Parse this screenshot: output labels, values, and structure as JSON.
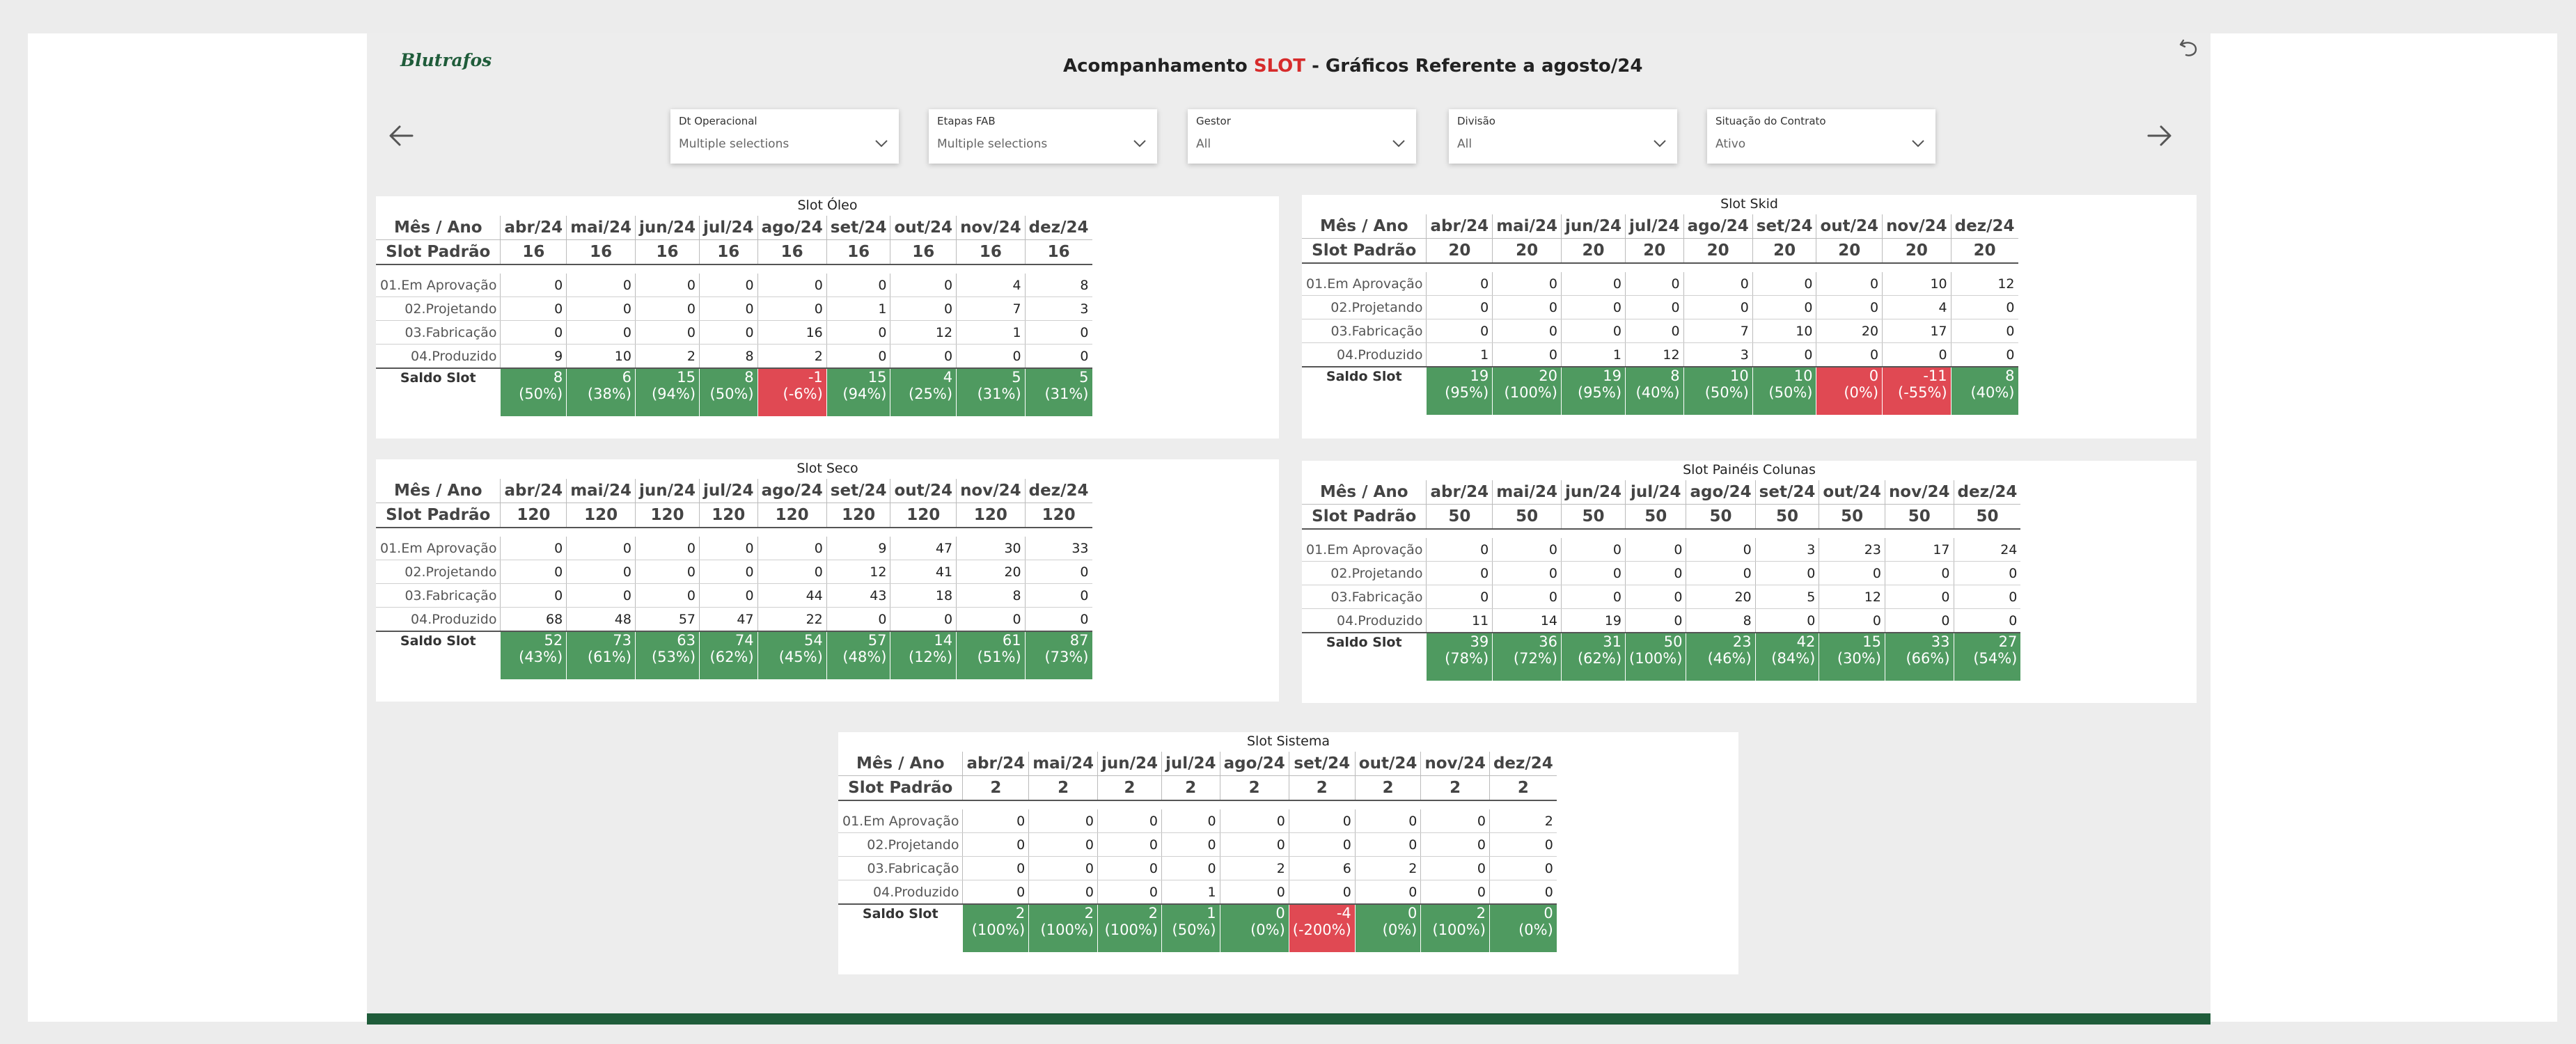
{
  "header": {
    "logo": "Blutrafos",
    "title_prefix": "Acompanhamento",
    "title_accent": "SLOT",
    "title_suffix": " - Gráficos Referente a agosto/24",
    "accent_color": "#d62b2b",
    "brand_color": "#1f5c3a"
  },
  "icons": {
    "undo": "undo-icon",
    "prev": "arrow-left-icon",
    "next": "arrow-right-icon",
    "dropdown": "chevron-down-icon"
  },
  "filters": [
    {
      "label": "Dt Operacional",
      "value": "Multiple selections"
    },
    {
      "label": "Etapas FAB",
      "value": "Multiple selections"
    },
    {
      "label": "Gestor",
      "value": "All"
    },
    {
      "label": "Divisão",
      "value": "All"
    },
    {
      "label": "Situação do Contrato",
      "value": "Ativo"
    }
  ],
  "table_labels": {
    "header": "Mês / Ano",
    "padrao": "Slot Padrão",
    "saldo": "Saldo Slot"
  },
  "months": [
    "abr/24",
    "mai/24",
    "jun/24",
    "jul/24",
    "ago/24",
    "set/24",
    "out/24",
    "nov/24",
    "dez/24"
  ],
  "stage_labels": [
    "01.Em Aprovação",
    "02.Projetando",
    "03.Fabricação",
    "04.Produzido"
  ],
  "colors": {
    "positive": "#4f9a60",
    "negative": "#e04953"
  },
  "panels": [
    {
      "title": "Slot Óleo",
      "padrao": [
        "16",
        "16",
        "16",
        "16",
        "16",
        "16",
        "16",
        "16",
        "16"
      ],
      "stages": [
        [
          "0",
          "0",
          "0",
          "0",
          "0",
          "0",
          "0",
          "4",
          "8"
        ],
        [
          "0",
          "0",
          "0",
          "0",
          "0",
          "1",
          "0",
          "7",
          "3"
        ],
        [
          "0",
          "0",
          "0",
          "0",
          "16",
          "0",
          "12",
          "1",
          "0"
        ],
        [
          "9",
          "10",
          "2",
          "8",
          "2",
          "0",
          "0",
          "0",
          "0"
        ]
      ],
      "saldo": [
        {
          "v": "8",
          "p": "(50%)",
          "neg": false
        },
        {
          "v": "6",
          "p": "(38%)",
          "neg": false
        },
        {
          "v": "15",
          "p": "(94%)",
          "neg": false
        },
        {
          "v": "8",
          "p": "(50%)",
          "neg": false
        },
        {
          "v": "-1",
          "p": "(-6%)",
          "neg": true
        },
        {
          "v": "15",
          "p": "(94%)",
          "neg": false
        },
        {
          "v": "4",
          "p": "(25%)",
          "neg": false
        },
        {
          "v": "5",
          "p": "(31%)",
          "neg": false
        },
        {
          "v": "5",
          "p": "(31%)",
          "neg": false
        }
      ]
    },
    {
      "title": "Slot Skid",
      "padrao": [
        "20",
        "20",
        "20",
        "20",
        "20",
        "20",
        "20",
        "20",
        "20"
      ],
      "stages": [
        [
          "0",
          "0",
          "0",
          "0",
          "0",
          "0",
          "0",
          "10",
          "12"
        ],
        [
          "0",
          "0",
          "0",
          "0",
          "0",
          "0",
          "0",
          "4",
          "0"
        ],
        [
          "0",
          "0",
          "0",
          "0",
          "7",
          "10",
          "20",
          "17",
          "0"
        ],
        [
          "1",
          "0",
          "1",
          "12",
          "3",
          "0",
          "0",
          "0",
          "0"
        ]
      ],
      "saldo": [
        {
          "v": "19",
          "p": "(95%)",
          "neg": false
        },
        {
          "v": "20",
          "p": "(100%)",
          "neg": false
        },
        {
          "v": "19",
          "p": "(95%)",
          "neg": false
        },
        {
          "v": "8",
          "p": "(40%)",
          "neg": false
        },
        {
          "v": "10",
          "p": "(50%)",
          "neg": false
        },
        {
          "v": "10",
          "p": "(50%)",
          "neg": false
        },
        {
          "v": "0",
          "p": "(0%)",
          "neg": true
        },
        {
          "v": "-11",
          "p": "(-55%)",
          "neg": true
        },
        {
          "v": "8",
          "p": "(40%)",
          "neg": false
        }
      ]
    },
    {
      "title": "Slot Seco",
      "padrao": [
        "120",
        "120",
        "120",
        "120",
        "120",
        "120",
        "120",
        "120",
        "120"
      ],
      "stages": [
        [
          "0",
          "0",
          "0",
          "0",
          "0",
          "9",
          "47",
          "30",
          "33"
        ],
        [
          "0",
          "0",
          "0",
          "0",
          "0",
          "12",
          "41",
          "20",
          "0"
        ],
        [
          "0",
          "0",
          "0",
          "0",
          "44",
          "43",
          "18",
          "8",
          "0"
        ],
        [
          "68",
          "48",
          "57",
          "47",
          "22",
          "0",
          "0",
          "0",
          "0"
        ]
      ],
      "saldo": [
        {
          "v": "52",
          "p": "(43%)",
          "neg": false
        },
        {
          "v": "73",
          "p": "(61%)",
          "neg": false
        },
        {
          "v": "63",
          "p": "(53%)",
          "neg": false
        },
        {
          "v": "74",
          "p": "(62%)",
          "neg": false
        },
        {
          "v": "54",
          "p": "(45%)",
          "neg": false
        },
        {
          "v": "57",
          "p": "(48%)",
          "neg": false
        },
        {
          "v": "14",
          "p": "(12%)",
          "neg": false
        },
        {
          "v": "61",
          "p": "(51%)",
          "neg": false
        },
        {
          "v": "87",
          "p": "(73%)",
          "neg": false
        }
      ]
    },
    {
      "title": "Slot Painéis Colunas",
      "padrao": [
        "50",
        "50",
        "50",
        "50",
        "50",
        "50",
        "50",
        "50",
        "50"
      ],
      "stages": [
        [
          "0",
          "0",
          "0",
          "0",
          "0",
          "3",
          "23",
          "17",
          "24"
        ],
        [
          "0",
          "0",
          "0",
          "0",
          "0",
          "0",
          "0",
          "0",
          "0"
        ],
        [
          "0",
          "0",
          "0",
          "0",
          "20",
          "5",
          "12",
          "0",
          "0"
        ],
        [
          "11",
          "14",
          "19",
          "0",
          "8",
          "0",
          "0",
          "0",
          "0"
        ]
      ],
      "saldo": [
        {
          "v": "39",
          "p": "(78%)",
          "neg": false
        },
        {
          "v": "36",
          "p": "(72%)",
          "neg": false
        },
        {
          "v": "31",
          "p": "(62%)",
          "neg": false
        },
        {
          "v": "50",
          "p": "(100%)",
          "neg": false
        },
        {
          "v": "23",
          "p": "(46%)",
          "neg": false
        },
        {
          "v": "42",
          "p": "(84%)",
          "neg": false
        },
        {
          "v": "15",
          "p": "(30%)",
          "neg": false
        },
        {
          "v": "33",
          "p": "(66%)",
          "neg": false
        },
        {
          "v": "27",
          "p": "(54%)",
          "neg": false
        }
      ]
    },
    {
      "title": "Slot Sistema",
      "padrao": [
        "2",
        "2",
        "2",
        "2",
        "2",
        "2",
        "2",
        "2",
        "2"
      ],
      "stages": [
        [
          "0",
          "0",
          "0",
          "0",
          "0",
          "0",
          "0",
          "0",
          "2"
        ],
        [
          "0",
          "0",
          "0",
          "0",
          "0",
          "0",
          "0",
          "0",
          "0"
        ],
        [
          "0",
          "0",
          "0",
          "0",
          "2",
          "6",
          "2",
          "0",
          "0"
        ],
        [
          "0",
          "0",
          "0",
          "1",
          "0",
          "0",
          "0",
          "0",
          "0"
        ]
      ],
      "saldo": [
        {
          "v": "2",
          "p": "(100%)",
          "neg": false
        },
        {
          "v": "2",
          "p": "(100%)",
          "neg": false
        },
        {
          "v": "2",
          "p": "(100%)",
          "neg": false
        },
        {
          "v": "1",
          "p": "(50%)",
          "neg": false
        },
        {
          "v": "0",
          "p": "(0%)",
          "neg": false
        },
        {
          "v": "-4",
          "p": "(-200%)",
          "neg": true
        },
        {
          "v": "0",
          "p": "(0%)",
          "neg": false
        },
        {
          "v": "2",
          "p": "(100%)",
          "neg": false
        },
        {
          "v": "0",
          "p": "(0%)",
          "neg": false
        }
      ]
    }
  ]
}
